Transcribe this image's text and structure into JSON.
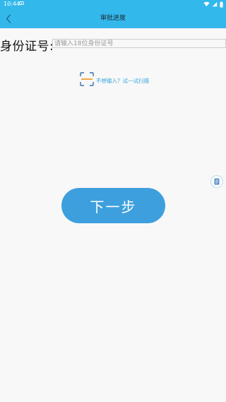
{
  "status_bar": {
    "time": "10:44",
    "notification_icon": "notification-icon"
  },
  "nav": {
    "title": "审批进度",
    "back_icon": "chevron-left-icon"
  },
  "form": {
    "id_label": "身份证号:",
    "id_placeholder": "请输入18位身份证号",
    "id_value": ""
  },
  "scan": {
    "icon": "scan-frame-icon",
    "text": "不想输入？试一试扫描"
  },
  "actions": {
    "next_label": "下一步"
  },
  "floating": {
    "icon": "document-icon"
  },
  "colors": {
    "header": "#33b8ec",
    "button": "#3d9fdd",
    "link": "#3aa6e0",
    "scan_accent": "#f0a030",
    "background": "#f8f8f8"
  }
}
